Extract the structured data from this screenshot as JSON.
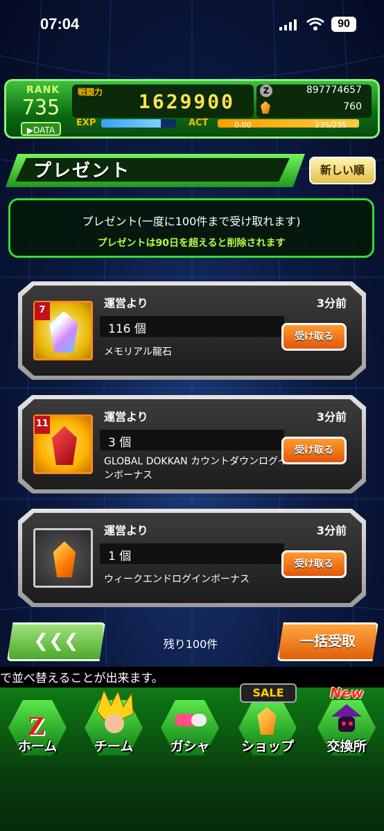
{
  "status_bar": {
    "time": "07:04",
    "battery": "90"
  },
  "rank_panel": {
    "rank_label": "RANK",
    "rank_value": "735",
    "data_button": "DATA",
    "battle_power_label": "戦闘力",
    "battle_power": "1629900",
    "zeni_icon": "Z",
    "zeni": "897774657",
    "dragon_stones": "760",
    "exp_label": "EXP",
    "exp_fill_pct": 80,
    "act_label": "ACT",
    "act_time": "0:00",
    "act_value": "235/235",
    "act_fill_pct": 100
  },
  "header": {
    "title": "プレゼント",
    "sort_button": "新しい順"
  },
  "info": {
    "line1": "プレゼント(一度に100件まで受け取れます)",
    "line2": "プレゼントは90日を超えると削除されます"
  },
  "gifts": [
    {
      "from": "運営より",
      "time": "3分前",
      "quantity": "116 個",
      "name": "メモリアル龍石",
      "badge": "7",
      "icon": "rainbow-crystal-icon",
      "button": "受け取る"
    },
    {
      "from": "運営より",
      "time": "3分前",
      "quantity": "3 個",
      "name": "GLOBAL DOKKAN カウントダウンログインボーナス",
      "badge": "11",
      "icon": "red-crystal-icon",
      "button": "受け取る"
    },
    {
      "from": "運営より",
      "time": "3分前",
      "quantity": "1 個",
      "name": "ウィークエンドログインボーナス",
      "badge": "",
      "icon": "dragon-stone-icon",
      "button": "受け取る"
    }
  ],
  "footer": {
    "back_button": "❮❮❮",
    "remaining": "残り100件",
    "bulk_button": "一括受取"
  },
  "ticker": "で並べ替えることが出来ます。",
  "nav": [
    {
      "label": "ホーム",
      "icon": "z-logo-icon"
    },
    {
      "label": "チーム",
      "icon": "team-characters-icon"
    },
    {
      "label": "ガシャ",
      "icon": "capsule-icon"
    },
    {
      "label": "ショップ",
      "icon": "dragon-stone-icon",
      "badge": "SALE"
    },
    {
      "label": "交換所",
      "icon": "exchange-character-icon",
      "badge": "New"
    }
  ],
  "colors": {
    "accent_green": "#2fe02f",
    "button_orange": "#e0560a",
    "highlight_text": "#b8ff3c"
  }
}
